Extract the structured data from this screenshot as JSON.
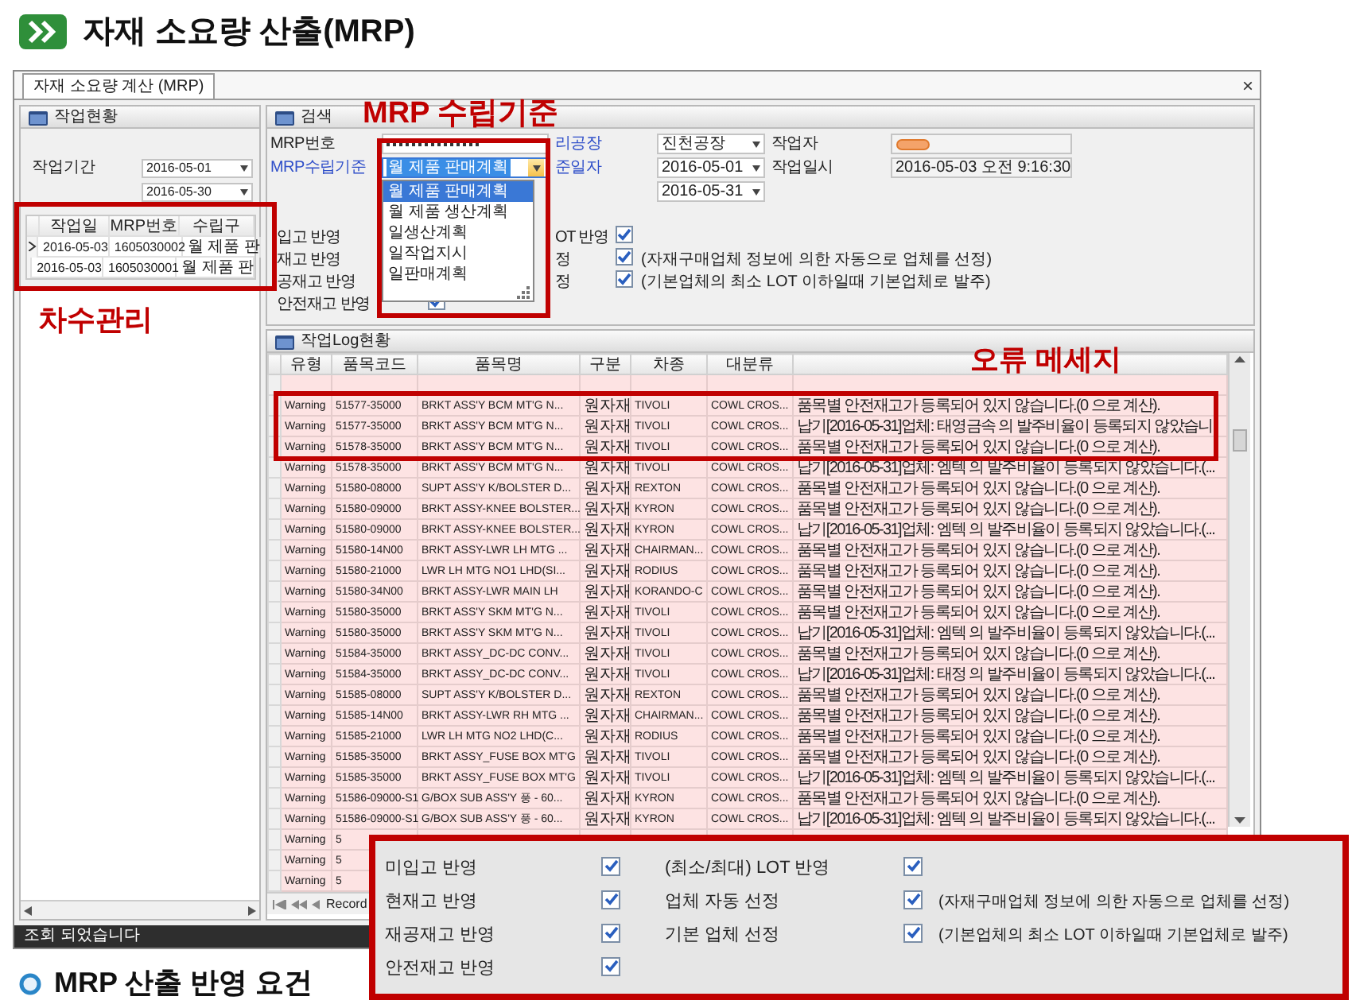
{
  "header": {
    "title": "자재 소요량 산출(MRP)"
  },
  "window": {
    "tab": "자재 소요량 계산 (MRP)",
    "close": "×",
    "status": "조회 되었습니다"
  },
  "work_status": {
    "title": "작업현황",
    "period_label": "작업기간",
    "period": [
      "2016-05-01",
      "2016-05-30"
    ],
    "grid": {
      "columns": [
        "작업일",
        "MRP번호",
        "수립구"
      ],
      "rows": [
        {
          "cells": [
            "2016-05-03",
            "1605030002",
            "월 제품 판"
          ],
          "selected": true
        },
        {
          "cells": [
            "2016-05-03",
            "1605030001",
            "월 제품 판"
          ],
          "selected": false
        }
      ]
    }
  },
  "search": {
    "title": "검색",
    "rows": [
      [
        {
          "kind": "masked",
          "label": "MRP번호",
          "required": false
        },
        {
          "kind": "select",
          "label": "리공장",
          "required": true,
          "value": "진천공장"
        },
        {
          "kind": "redacted",
          "label": "작업자",
          "required": false
        }
      ],
      [
        {
          "kind": "select",
          "label": "MRP수립기준",
          "required": true,
          "value": "월 제품 판매계획",
          "focused": true,
          "open": true,
          "options": [
            {
              "label": "월 제품 판매계획",
              "selected": true
            },
            {
              "label": "월 제품 생산계획",
              "selected": false
            },
            {
              "label": "일생산계획",
              "selected": false
            },
            {
              "label": "일작업지시",
              "selected": false
            },
            {
              "label": "일판매계획",
              "selected": false
            }
          ]
        },
        {
          "kind": "select",
          "label": "준일자",
          "required": true,
          "value": "2016-05-01"
        },
        {
          "kind": "text",
          "label": "작업일시",
          "required": false,
          "value": "2016-05-03 오전 9:16:30"
        }
      ],
      [
        {
          "kind": "empty"
        },
        {
          "kind": "select",
          "value": "2016-05-31"
        }
      ]
    ],
    "options_left": [
      {
        "label": "입고 반영"
      },
      {
        "label": "재고 반영"
      },
      {
        "label": "공재고 반영"
      },
      {
        "label": "안전재고 반영",
        "checked": true
      }
    ],
    "options_right": [
      {
        "label": "OT 반영",
        "checked": true
      },
      {
        "label": "정",
        "checked": true,
        "note": "(자재구매업체 정보에 의한 자동으로 업체를 선정)"
      },
      {
        "label": "정",
        "checked": true,
        "note": "(기본업체의 최소 LOT 이하일때 기본업체로 발주)"
      }
    ]
  },
  "log": {
    "title": "작업Log현황",
    "columns": [
      "유형",
      "품목코드",
      "품목명",
      "구분",
      "차종",
      "대분류"
    ],
    "rows": [
      [
        "Warning",
        "51577-35000",
        "BRKT ASS'Y BCM MT'G N...",
        "원자재",
        "TIVOLI",
        "COWL CROS...",
        "품목별 안전재고가 등록되어 있지 않습니다.(0 으로 계산)."
      ],
      [
        "Warning",
        "51577-35000",
        "BRKT ASS'Y BCM MT'G N...",
        "원자재",
        "TIVOLI",
        "COWL CROS...",
        "납기[2016-05-31]업체: 태영금속 의 발주비율이 등록되지 않았습니"
      ],
      [
        "Warning",
        "51578-35000",
        "BRKT ASS'Y BCM MT'G N...",
        "원자재",
        "TIVOLI",
        "COWL CROS...",
        "품목별 안전재고가 등록되어 있지 않습니다.(0 으로 계산)."
      ],
      [
        "Warning",
        "51578-35000",
        "BRKT ASS'Y BCM MT'G N...",
        "원자재",
        "TIVOLI",
        "COWL CROS...",
        "납기[2016-05-31]업체: 엠텍 의 발주비율이 등록되지 않았습니다.(..."
      ],
      [
        "Warning",
        "51580-08000",
        "SUPT ASS'Y K/BOLSTER D...",
        "원자재",
        "REXTON",
        "COWL CROS...",
        "품목별 안전재고가 등록되어 있지 않습니다.(0 으로 계산)."
      ],
      [
        "Warning",
        "51580-09000",
        "BRKT ASSY-KNEE BOLSTER...",
        "원자재",
        "KYRON",
        "COWL CROS...",
        "품목별 안전재고가 등록되어 있지 않습니다.(0 으로 계산)."
      ],
      [
        "Warning",
        "51580-09000",
        "BRKT ASSY-KNEE BOLSTER...",
        "원자재",
        "KYRON",
        "COWL CROS...",
        "납기[2016-05-31]업체: 엠텍 의 발주비율이 등록되지 않았습니다.(..."
      ],
      [
        "Warning",
        "51580-14N00",
        "BRKT ASSY-LWR LH MTG ...",
        "원자재",
        "CHAIRMAN...",
        "COWL CROS...",
        "품목별 안전재고가 등록되어 있지 않습니다.(0 으로 계산)."
      ],
      [
        "Warning",
        "51580-21000",
        "LWR LH MTG NO1 LHD(SI...",
        "원자재",
        "RODIUS",
        "COWL CROS...",
        "품목별 안전재고가 등록되어 있지 않습니다.(0 으로 계산)."
      ],
      [
        "Warning",
        "51580-34N00",
        "BRKT ASSY-LWR MAIN LH",
        "원자재",
        "KORANDO-C",
        "COWL CROS...",
        "품목별 안전재고가 등록되어 있지 않습니다.(0 으로 계산)."
      ],
      [
        "Warning",
        "51580-35000",
        "BRKT ASS'Y SKM MT'G N...",
        "원자재",
        "TIVOLI",
        "COWL CROS...",
        "품목별 안전재고가 등록되어 있지 않습니다.(0 으로 계산)."
      ],
      [
        "Warning",
        "51580-35000",
        "BRKT ASS'Y SKM MT'G N...",
        "원자재",
        "TIVOLI",
        "COWL CROS...",
        "납기[2016-05-31]업체: 엠텍 의 발주비율이 등록되지 않았습니다.(..."
      ],
      [
        "Warning",
        "51584-35000",
        "BRKT ASSY_DC-DC CONV...",
        "원자재",
        "TIVOLI",
        "COWL CROS...",
        "품목별 안전재고가 등록되어 있지 않습니다.(0 으로 계산)."
      ],
      [
        "Warning",
        "51584-35000",
        "BRKT ASSY_DC-DC CONV...",
        "원자재",
        "TIVOLI",
        "COWL CROS...",
        "납기[2016-05-31]업체: 태정 의 발주비율이 등록되지 않았습니다.(..."
      ],
      [
        "Warning",
        "51585-08000",
        "SUPT ASS'Y K/BOLSTER D...",
        "원자재",
        "REXTON",
        "COWL CROS...",
        "품목별 안전재고가 등록되어 있지 않습니다.(0 으로 계산)."
      ],
      [
        "Warning",
        "51585-14N00",
        "BRKT ASSY-LWR RH MTG ...",
        "원자재",
        "CHAIRMAN...",
        "COWL CROS...",
        "품목별 안전재고가 등록되어 있지 않습니다.(0 으로 계산)."
      ],
      [
        "Warning",
        "51585-21000",
        "LWR LH MTG NO2 LHD(C...",
        "원자재",
        "RODIUS",
        "COWL CROS...",
        "품목별 안전재고가 등록되어 있지 않습니다.(0 으로 계산)."
      ],
      [
        "Warning",
        "51585-35000",
        "BRKT ASSY_FUSE BOX MT'G",
        "원자재",
        "TIVOLI",
        "COWL CROS...",
        "품목별 안전재고가 등록되어 있지 않습니다.(0 으로 계산)."
      ],
      [
        "Warning",
        "51585-35000",
        "BRKT ASSY_FUSE BOX MT'G",
        "원자재",
        "TIVOLI",
        "COWL CROS...",
        "납기[2016-05-31]업체: 엠텍 의 발주비율이 등록되지 않았습니다.(..."
      ],
      [
        "Warning",
        "51586-09000-S1",
        "G/BOX SUB ASS'Y 풍 - 60...",
        "원자재",
        "KYRON",
        "COWL CROS...",
        "품목별 안전재고가 등록되어 있지 않습니다.(0 으로 계산)."
      ],
      [
        "Warning",
        "51586-09000-S1",
        "G/BOX SUB ASS'Y 풍 - 60...",
        "원자재",
        "KYRON",
        "COWL CROS...",
        "납기[2016-05-31]업체: 엠텍 의 발주비율이 등록되지 않았습니다.(..."
      ],
      [
        "Warning",
        "5"
      ],
      [
        "Warning",
        "5"
      ],
      [
        "Warning",
        "5"
      ]
    ],
    "pager": "Record"
  },
  "annotations": [
    {
      "text": "MRP 수립기준"
    },
    {
      "text": "차수관리"
    },
    {
      "text": "오류 메세지"
    }
  ],
  "callout": {
    "left": [
      {
        "label": "미입고 반영",
        "checked": true
      },
      {
        "label": "현재고 반영",
        "checked": true
      },
      {
        "label": "재공재고 반영",
        "checked": true
      },
      {
        "label": "안전재고 반영",
        "checked": true
      }
    ],
    "right": [
      {
        "label": "(최소/최대) LOT 반영",
        "checked": true
      },
      {
        "label": "업체 자동 선정",
        "checked": true,
        "note": "(자재구매업체 정보에 의한 자동으로 업체를 선정)"
      },
      {
        "label": "기본 업체 선정",
        "checked": true,
        "note": "(기본업체의 최소 LOT 이하일때 기본업체로 발주)"
      }
    ]
  },
  "caption": "MRP 산출 반영 요건"
}
